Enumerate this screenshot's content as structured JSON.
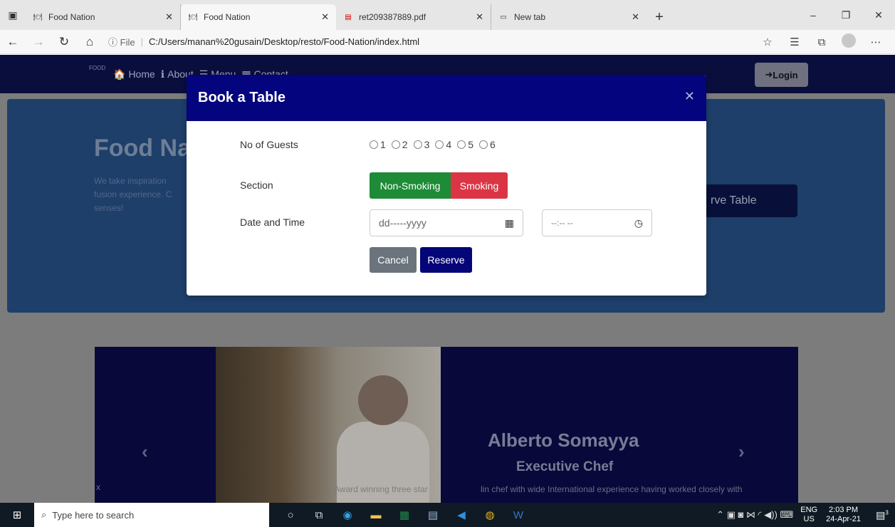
{
  "browser": {
    "tabs": [
      {
        "title": "Food Nation",
        "active": false
      },
      {
        "title": "Food Nation",
        "active": true
      },
      {
        "title": "ret209387889.pdf",
        "active": false
      },
      {
        "title": "New tab",
        "active": false
      }
    ],
    "address": {
      "scheme_label": "File",
      "url": "C:/Users/manan%20gusain/Desktop/resto/Food-Nation/index.html"
    }
  },
  "navbar": {
    "brand_text": "FOOD",
    "links": [
      "Home",
      "About",
      "Menu",
      "Contact"
    ],
    "login_label": "Login"
  },
  "hero": {
    "title": "Food Na",
    "description_lines": [
      "We take inspiration",
      "fusion experience. C",
      "senses!"
    ],
    "reserve_label": "rve Table"
  },
  "carousel": {
    "chef_name": "Alberto Somayya",
    "chef_role": "Executive Chef",
    "description": "lin chef with wide International experience having worked closely with",
    "photo_caption": "Award winning three star",
    "left_text": "x"
  },
  "modal": {
    "title": "Book a Table",
    "guests_label": "No of Guests",
    "guest_options": [
      "1",
      "2",
      "3",
      "4",
      "5",
      "6"
    ],
    "section_label": "Section",
    "section_options": [
      "Non-Smoking",
      "Smoking"
    ],
    "datetime_label": "Date and Time",
    "date_placeholder": "dd-----yyyy",
    "time_placeholder": "--:-- --",
    "cancel_label": "Cancel",
    "reserve_label": "Reserve",
    "colors": {
      "header": "#03047e",
      "non_smoking": "#1e8b37",
      "smoking": "#db3545"
    }
  },
  "taskbar": {
    "search_placeholder": "Type here to search",
    "lang_top": "ENG",
    "lang_bottom": "US",
    "time": "2:03 PM",
    "date": "24-Apr-21",
    "notif_count": "3"
  }
}
